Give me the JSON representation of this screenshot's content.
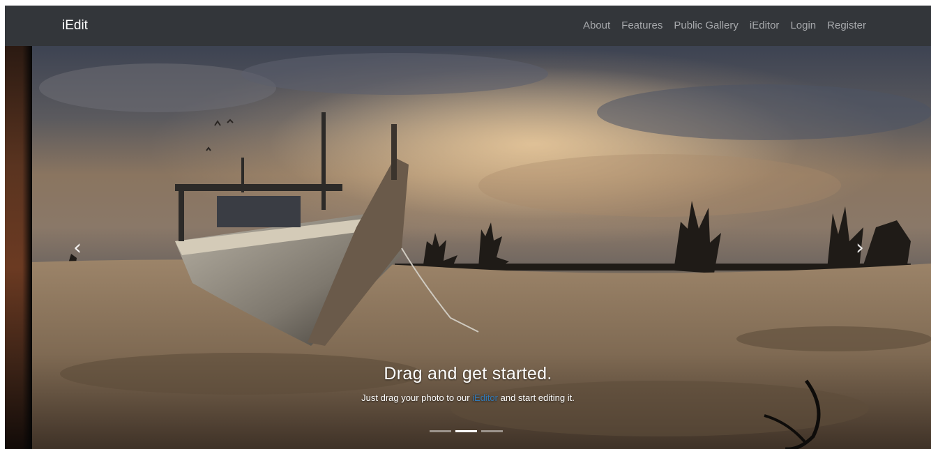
{
  "navbar": {
    "brand": "iEdit",
    "links": [
      "About",
      "Features",
      "Public Gallery",
      "iEditor",
      "Login",
      "Register"
    ]
  },
  "carousel": {
    "prev_icon": "chevron-left-icon",
    "next_icon": "chevron-right-icon",
    "prev_glyph": "‹",
    "next_glyph": "›",
    "caption": {
      "title": "Drag and get started.",
      "text_before": "Just drag your photo to our ",
      "link": "iEditor",
      "text_after": " and start editing it."
    },
    "indicator_count": 3,
    "active_indicator": 1
  },
  "colors": {
    "navbar_bg": "#33363a",
    "nav_link": "#a6a8ab",
    "brand": "#ffffff",
    "caption_link": "#337ab7"
  }
}
